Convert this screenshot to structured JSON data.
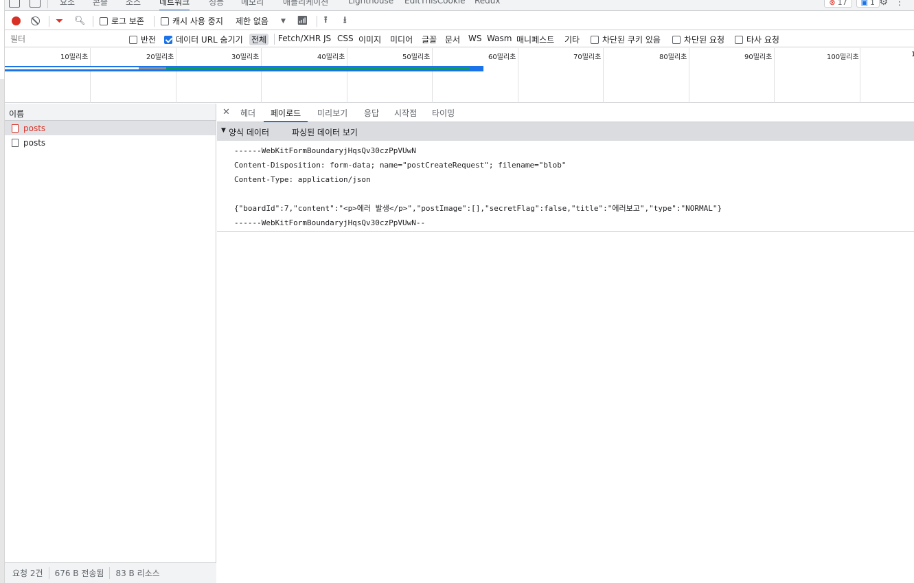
{
  "panel_tabs": [
    "요소",
    "콘솔",
    "소스",
    "네트워크",
    "성능",
    "메모리",
    "애플리케이션",
    "Lighthouse",
    "EditThisCookie",
    "Redux"
  ],
  "badges": {
    "errors": "17",
    "messages": "1"
  },
  "toolbar": {
    "preserve_log": "로그 보존",
    "disable_cache": "캐시 사용 중지",
    "throttle": "제한 없음"
  },
  "filter": {
    "placeholder": "필터",
    "invert": "반전",
    "hide_data_urls": "데이터 URL 숨기기",
    "types": [
      "전체",
      "Fetch/XHR",
      "JS",
      "CSS",
      "이미지",
      "미디어",
      "글꼴",
      "문서",
      "WS",
      "Wasm",
      "매니페스트",
      "기타"
    ],
    "blocked_cookies": "차단된 쿠키 있음",
    "blocked_requests": "차단된 요청",
    "third_party": "타사 요청"
  },
  "timeline_ticks": [
    "10밀리초",
    "20밀리초",
    "30밀리초",
    "40밀리초",
    "50밀리초",
    "60밀리초",
    "70밀리초",
    "80밀리초",
    "90밀리초",
    "100밀리초",
    "1"
  ],
  "request_list": {
    "header": "이름",
    "rows": [
      {
        "name": "posts",
        "error": true
      },
      {
        "name": "posts",
        "error": false
      }
    ]
  },
  "status": {
    "requests": "요청 2건",
    "transferred": "676 B 전송됨",
    "resources": "83 B 리소스"
  },
  "detail": {
    "tabs": [
      "헤더",
      "페이로드",
      "미리보기",
      "응답",
      "시작점",
      "타이밍"
    ],
    "section_title": "양식 데이터",
    "section_link": "파싱된 데이터 보기",
    "lines": [
      "------WebKitFormBoundaryjHqsQv30czPpVUwN",
      "Content-Disposition: form-data; name=\"postCreateRequest\"; filename=\"blob\"",
      "Content-Type: application/json",
      "",
      "{\"boardId\":7,\"content\":\"<p>에러 발생</p>\",\"postImage\":[],\"secretFlag\":false,\"title\":\"에러보고\",\"type\":\"NORMAL\"}",
      "------WebKitFormBoundaryjHqsQv30czPpVUwN--"
    ]
  }
}
